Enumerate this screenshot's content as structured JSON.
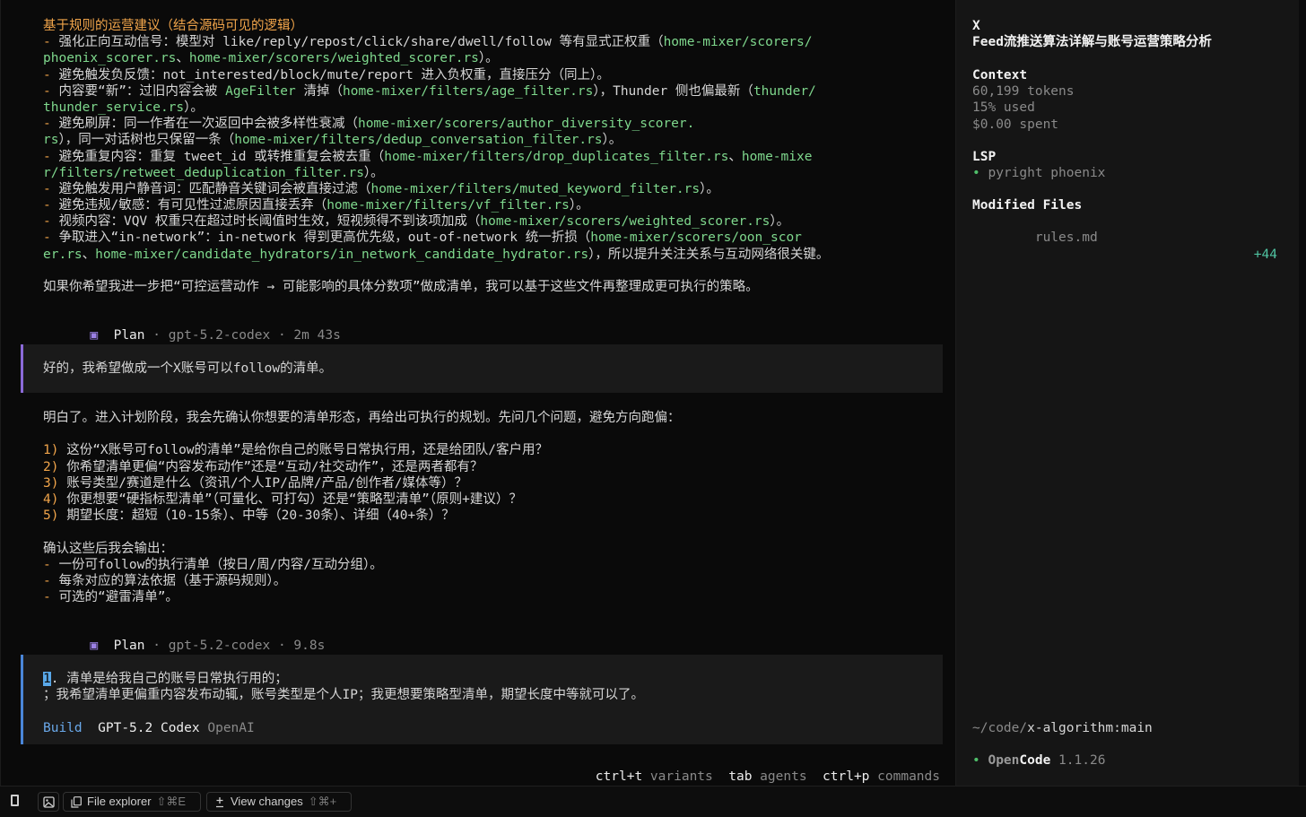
{
  "messages": {
    "block1": [
      [
        {
          "t": "基于规则的运营建议（结合源码可见的逻辑）",
          "c": "orange"
        }
      ],
      [
        {
          "t": "- ",
          "c": "orange"
        },
        {
          "t": "强化正向互动信号：模型对 like/reply/repost/click/share/dwell/follow 等有显式正权重（"
        },
        {
          "t": "home-mixer/scorers/",
          "c": "green"
        }
      ],
      [
        {
          "t": "phoenix_scorer.rs",
          "c": "green"
        },
        {
          "t": "、"
        },
        {
          "t": "home-mixer/scorers/weighted_scorer.rs",
          "c": "green"
        },
        {
          "t": "）。"
        }
      ],
      [
        {
          "t": "- ",
          "c": "orange"
        },
        {
          "t": "避免触发负反馈：not_interested/block/mute/report 进入负权重，直接压分（同上）。"
        }
      ],
      [
        {
          "t": "- ",
          "c": "orange"
        },
        {
          "t": "内容要“新”：过旧内容会被 "
        },
        {
          "t": "AgeFilter",
          "c": "green"
        },
        {
          "t": " 清掉（"
        },
        {
          "t": "home-mixer/filters/age_filter.rs",
          "c": "green"
        },
        {
          "t": "），Thunder 侧也偏最新（"
        },
        {
          "t": "thunder/",
          "c": "green"
        }
      ],
      [
        {
          "t": "thunder_service.rs",
          "c": "green"
        },
        {
          "t": "）。"
        }
      ],
      [
        {
          "t": "- ",
          "c": "orange"
        },
        {
          "t": "避免刷屏：同一作者在一次返回中会被多样性衰减（"
        },
        {
          "t": "home-mixer/scorers/author_diversity_scorer.",
          "c": "green"
        }
      ],
      [
        {
          "t": "rs",
          "c": "green"
        },
        {
          "t": "），同一对话树也只保留一条（"
        },
        {
          "t": "home-mixer/filters/dedup_conversation_filter.rs",
          "c": "green"
        },
        {
          "t": "）。"
        }
      ],
      [
        {
          "t": "- ",
          "c": "orange"
        },
        {
          "t": "避免重复内容：重复 tweet_id 或转推重复会被去重（"
        },
        {
          "t": "home-mixer/filters/drop_duplicates_filter.rs",
          "c": "green"
        },
        {
          "t": "、"
        },
        {
          "t": "home-mixe",
          "c": "green"
        }
      ],
      [
        {
          "t": "r/filters/retweet_deduplication_filter.rs",
          "c": "green"
        },
        {
          "t": "）。"
        }
      ],
      [
        {
          "t": "- ",
          "c": "orange"
        },
        {
          "t": "避免触发用户静音词：匹配静音关键词会被直接过滤（"
        },
        {
          "t": "home-mixer/filters/muted_keyword_filter.rs",
          "c": "green"
        },
        {
          "t": "）。"
        }
      ],
      [
        {
          "t": "- ",
          "c": "orange"
        },
        {
          "t": "避免违规/敏感：有可见性过滤原因直接丢弃（"
        },
        {
          "t": "home-mixer/filters/vf_filter.rs",
          "c": "green"
        },
        {
          "t": "）。"
        }
      ],
      [
        {
          "t": "- ",
          "c": "orange"
        },
        {
          "t": "视频内容：VQV 权重只在超过时长阈值时生效，短视频得不到该项加成（"
        },
        {
          "t": "home-mixer/scorers/weighted_scorer.rs",
          "c": "green"
        },
        {
          "t": "）。"
        }
      ],
      [
        {
          "t": "- ",
          "c": "orange"
        },
        {
          "t": "争取进入“in-network”：in-network 得到更高优先级，out-of-network 统一折损（"
        },
        {
          "t": "home-mixer/scorers/oon_scor",
          "c": "green"
        }
      ],
      [
        {
          "t": "er.rs",
          "c": "green"
        },
        {
          "t": "、"
        },
        {
          "t": "home-mixer/candidate_hydrators/in_network_candidate_hydrator.rs",
          "c": "green"
        },
        {
          "t": "），所以提升关注关系与互动网络很关键。"
        }
      ],
      [],
      [
        {
          "t": "如果你希望我进一步把“可控运营动作 → 可能影响的具体分数项”做成清单，我可以基于这些文件再整理成更可执行的策略。"
        }
      ]
    ],
    "status1": {
      "mode": "Plan",
      "model": "gpt-5.2-codex",
      "time": "2m 43s"
    },
    "user1": "好的，我希望做成一个X账号可以follow的清单。",
    "block2": [
      [
        {
          "t": "明白了。进入计划阶段，我会先确认你想要的清单形态，再给出可执行的规划。先问几个问题，避免方向跑偏："
        }
      ],
      [],
      [
        {
          "t": "1) ",
          "c": "orange"
        },
        {
          "t": "这份“X账号可follow的清单”是给你自己的账号日常执行用，还是给团队/客户用？"
        }
      ],
      [
        {
          "t": "2) ",
          "c": "orange"
        },
        {
          "t": "你希望清单更偏“内容发布动作”还是“互动/社交动作”，还是两者都有？"
        }
      ],
      [
        {
          "t": "3) ",
          "c": "orange"
        },
        {
          "t": "账号类型/赛道是什么（资讯/个人IP/品牌/产品/创作者/媒体等）？"
        }
      ],
      [
        {
          "t": "4) ",
          "c": "orange"
        },
        {
          "t": "你更想要“硬指标型清单”（可量化、可打勾）还是“策略型清单”（原则+建议）？"
        }
      ],
      [
        {
          "t": "5) ",
          "c": "orange"
        },
        {
          "t": "期望长度：超短（10-15条）、中等（20-30条）、详细（40+条）？"
        }
      ],
      [],
      [
        {
          "t": "确认这些后我会输出："
        }
      ],
      [
        {
          "t": "- ",
          "c": "orange"
        },
        {
          "t": "一份可follow的执行清单（按日/周/内容/互动分组）。"
        }
      ],
      [
        {
          "t": "- ",
          "c": "orange"
        },
        {
          "t": "每条对应的算法依据（基于源码规则）。"
        }
      ],
      [
        {
          "t": "- ",
          "c": "orange"
        },
        {
          "t": "可选的“避雷清单”。"
        }
      ]
    ],
    "status2": {
      "mode": "Plan",
      "model": "gpt-5.2-codex",
      "time": "9.8s"
    },
    "input": {
      "cursor_char": "1",
      "line1_rest": ". 清单是给我自己的账号日常执行用的；",
      "line2": "；我希望清单更偏重内容发布动辄，账号类型是个人IP；我更想要策略型清单，期望长度中等就可以了。",
      "agent": "Build",
      "model": "GPT-5.2 Codex",
      "provider": "OpenAI"
    },
    "hints": [
      {
        "key": "ctrl+t",
        "label": "variants"
      },
      {
        "key": "tab",
        "label": "agents"
      },
      {
        "key": "ctrl+p",
        "label": "commands"
      }
    ]
  },
  "sidebar": {
    "title": "X",
    "subtitle": "Feed流推送算法详解与账号运营策略分析",
    "context_heading": "Context",
    "tokens": "60,199 tokens",
    "used": "15% used",
    "spent": "$0.00 spent",
    "lsp_heading": "LSP",
    "lsp_item": "pyright phoenix",
    "modified_heading": "Modified Files",
    "modified_file": "rules.md",
    "modified_count": "+44",
    "path_prefix": "~/code/",
    "path_repo": "x-algorithm:main",
    "app_name_a": "Open",
    "app_name_b": "Code",
    "app_version": "1.1.26"
  },
  "bottombar": {
    "file_explorer": "File explorer",
    "file_explorer_kbd": "⇧⌘E",
    "view_changes": "View changes",
    "view_changes_kbd": "⇧⌘+"
  },
  "colors": {
    "orange": "#f0a44a",
    "green": "#7fd88d",
    "purple": "#9b80e6",
    "blue": "#6aa9ea"
  }
}
